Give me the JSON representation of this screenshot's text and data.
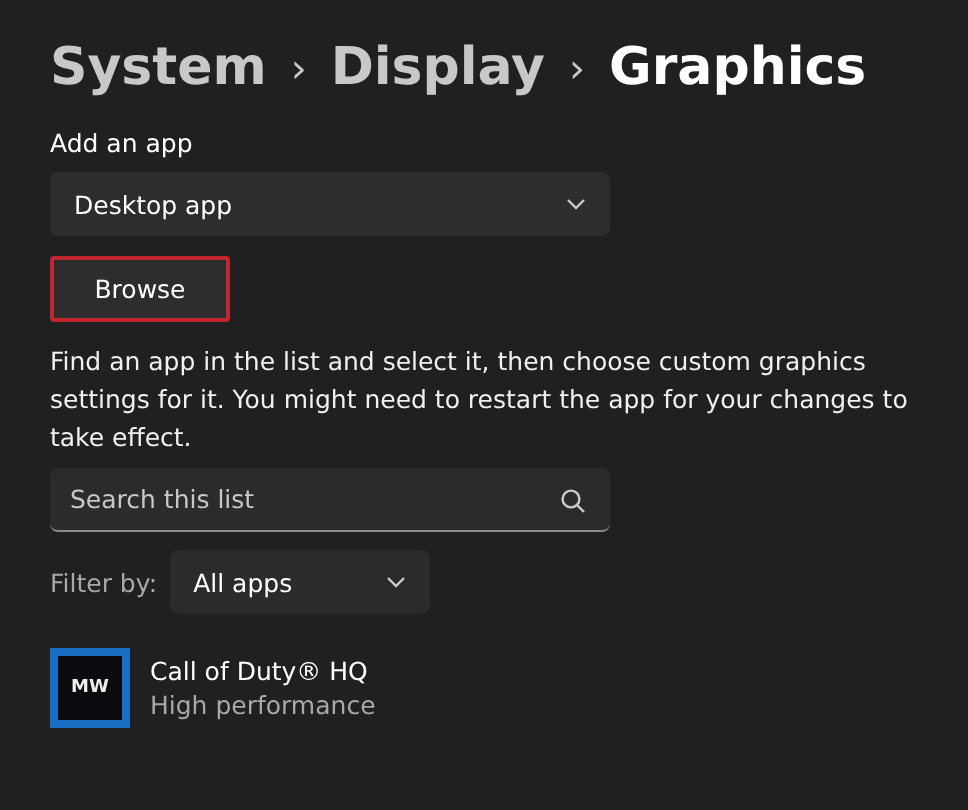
{
  "breadcrumb": [
    {
      "label": "System",
      "current": false
    },
    {
      "label": "Display",
      "current": false
    },
    {
      "label": "Graphics",
      "current": true
    }
  ],
  "separator": "›",
  "add_app": {
    "label": "Add an app",
    "dropdown": "Desktop app",
    "button": "Browse",
    "highlighted": true
  },
  "description": "Find an app in the list and select it, then choose custom graphics settings for it. You might need to restart the app for your changes to take effect.",
  "search": {
    "placeholder": "Search this list"
  },
  "filter": {
    "label": "Filter by:",
    "value": "All apps"
  },
  "apps": [
    {
      "name": "Call of Duty® HQ",
      "setting": "High performance",
      "icon_text": "MW"
    }
  ]
}
